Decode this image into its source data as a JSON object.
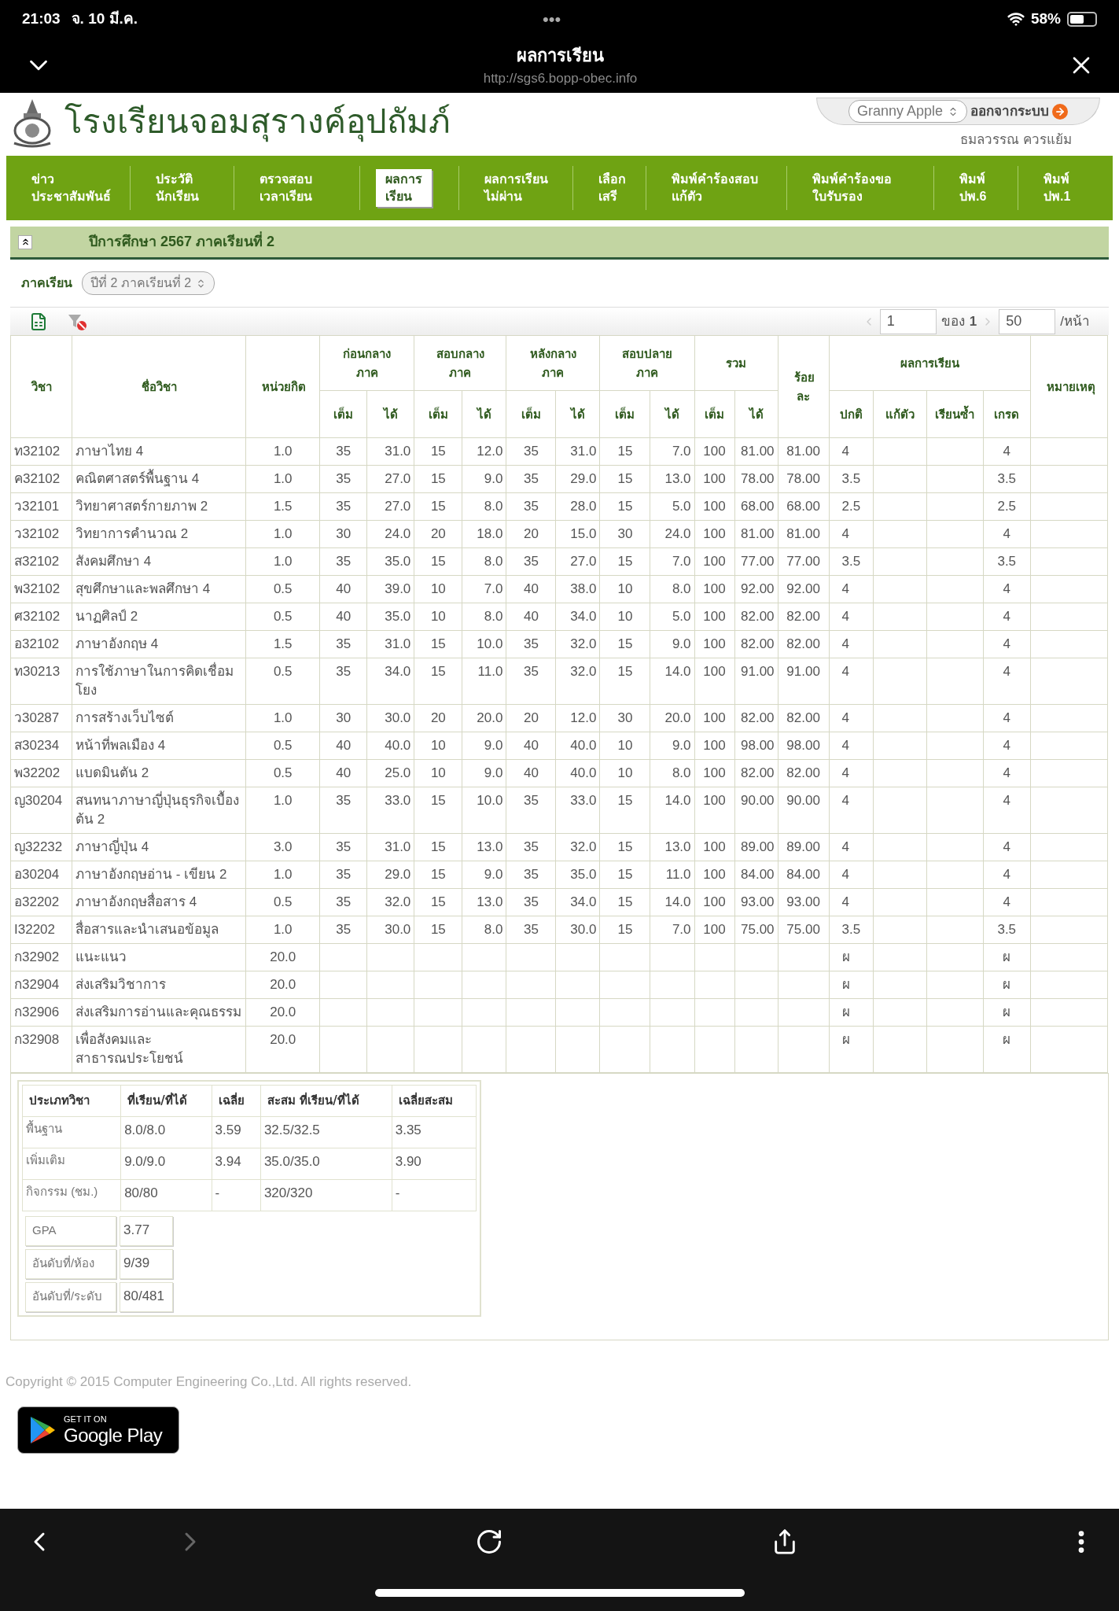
{
  "status_bar": {
    "time": "21:03",
    "date": "จ. 10 มี.ค.",
    "dots": "•••",
    "battery": "58%"
  },
  "browser": {
    "title": "ผลการเรียน",
    "url": "http://sgs6.bopp-obec.info"
  },
  "header": {
    "school_name": "โรงเรียนจอมสุรางค์อุปถัมภ์",
    "account_select": "Granny Apple",
    "logout": "ออกจากระบบ",
    "user_name": "ธมลวรรณ ควรแย้ม"
  },
  "nav": [
    {
      "lines": [
        "ข่าว",
        "ประชาสัมพันธ์"
      ],
      "selected": false
    },
    {
      "lines": [
        "ประวัติ",
        "นักเรียน"
      ],
      "selected": false
    },
    {
      "lines": [
        "ตรวจสอบ",
        "เวลาเรียน"
      ],
      "selected": false
    },
    {
      "lines": [
        "ผลการ",
        "เรียน"
      ],
      "selected": true
    },
    {
      "lines": [
        "ผลการเรียน",
        "ไม่ผ่าน"
      ],
      "selected": false
    },
    {
      "lines": [
        "เลือก",
        "เสรี"
      ],
      "selected": false
    },
    {
      "lines": [
        "พิมพ์คำร้องสอบ",
        "แก้ตัว"
      ],
      "selected": false
    },
    {
      "lines": [
        "พิมพ์คำร้องขอ",
        "ใบรับรอง"
      ],
      "selected": false
    },
    {
      "lines": [
        "พิมพ์",
        "ปพ.6"
      ],
      "selected": false
    },
    {
      "lines": [
        "พิมพ์",
        "ปพ.1"
      ],
      "selected": false
    }
  ],
  "section": {
    "title": "ปีการศึกษา 2567 ภาคเรียนที่ 2",
    "expanded": true
  },
  "semester": {
    "label": "ภาคเรียน",
    "value": "ปีที่ 2 ภาคเรียนที่ 2"
  },
  "pager": {
    "page": "1",
    "of": "ของ",
    "total": "1",
    "per_page": "50",
    "per_page_label": "/หน้า"
  },
  "table": {
    "columns": [
      {
        "label": "วิชา"
      },
      {
        "label": "ชื่อวิชา"
      },
      {
        "label": "หน่วยกิต"
      },
      {
        "label": "ก่อนกลางภาค",
        "sub": [
          "เต็ม",
          "ได้"
        ]
      },
      {
        "label": "สอบกลางภาค",
        "sub": [
          "เต็ม",
          "ได้"
        ]
      },
      {
        "label": "หลังกลางภาค",
        "sub": [
          "เต็ม",
          "ได้"
        ]
      },
      {
        "label": "สอบปลายภาค",
        "sub": [
          "เต็ม",
          "ได้"
        ]
      },
      {
        "label": "รวม",
        "sub": [
          "เต็ม",
          "ได้"
        ]
      },
      {
        "label": "ร้อยละ"
      },
      {
        "label": "ผลการเรียน",
        "sub": [
          "ปกติ",
          "แก้ตัว",
          "เรียนซ้ำ",
          "เกรด"
        ]
      },
      {
        "label": "หมายเหตุ"
      }
    ],
    "rows": [
      {
        "code": "ท32102",
        "name": "ภาษาไทย 4",
        "credit": "1.0",
        "scores": [
          "35",
          "31.0",
          "15",
          "12.0",
          "35",
          "31.0",
          "15",
          "7.0",
          "100",
          "81.00"
        ],
        "percent": "81.00",
        "normal": "4",
        "grade": "4"
      },
      {
        "code": "ค32102",
        "name": "คณิตศาสตร์พื้นฐาน 4",
        "credit": "1.0",
        "scores": [
          "35",
          "27.0",
          "15",
          "9.0",
          "35",
          "29.0",
          "15",
          "13.0",
          "100",
          "78.00"
        ],
        "percent": "78.00",
        "normal": "3.5",
        "grade": "3.5"
      },
      {
        "code": "ว32101",
        "name": "วิทยาศาสตร์กายภาพ 2",
        "credit": "1.5",
        "scores": [
          "35",
          "27.0",
          "15",
          "8.0",
          "35",
          "28.0",
          "15",
          "5.0",
          "100",
          "68.00"
        ],
        "percent": "68.00",
        "normal": "2.5",
        "grade": "2.5"
      },
      {
        "code": "ว32102",
        "name": "วิทยาการคำนวณ 2",
        "credit": "1.0",
        "scores": [
          "30",
          "24.0",
          "20",
          "18.0",
          "20",
          "15.0",
          "30",
          "24.0",
          "100",
          "81.00"
        ],
        "percent": "81.00",
        "normal": "4",
        "grade": "4"
      },
      {
        "code": "ส32102",
        "name": "สังคมศึกษา 4",
        "credit": "1.0",
        "scores": [
          "35",
          "35.0",
          "15",
          "8.0",
          "35",
          "27.0",
          "15",
          "7.0",
          "100",
          "77.00"
        ],
        "percent": "77.00",
        "normal": "3.5",
        "grade": "3.5"
      },
      {
        "code": "พ32102",
        "name": "สุขศึกษาและพลศึกษา 4",
        "credit": "0.5",
        "scores": [
          "40",
          "39.0",
          "10",
          "7.0",
          "40",
          "38.0",
          "10",
          "8.0",
          "100",
          "92.00"
        ],
        "percent": "92.00",
        "normal": "4",
        "grade": "4"
      },
      {
        "code": "ศ32102",
        "name": "นาฏศิลป์ 2",
        "credit": "0.5",
        "scores": [
          "40",
          "35.0",
          "10",
          "8.0",
          "40",
          "34.0",
          "10",
          "5.0",
          "100",
          "82.00"
        ],
        "percent": "82.00",
        "normal": "4",
        "grade": "4"
      },
      {
        "code": "อ32102",
        "name": "ภาษาอังกฤษ 4",
        "credit": "1.5",
        "scores": [
          "35",
          "31.0",
          "15",
          "10.0",
          "35",
          "32.0",
          "15",
          "9.0",
          "100",
          "82.00"
        ],
        "percent": "82.00",
        "normal": "4",
        "grade": "4"
      },
      {
        "code": "ท30213",
        "name": "การใช้ภาษาในการคิดเชื่อมโยง",
        "credit": "0.5",
        "scores": [
          "35",
          "34.0",
          "15",
          "11.0",
          "35",
          "32.0",
          "15",
          "14.0",
          "100",
          "91.00"
        ],
        "percent": "91.00",
        "normal": "4",
        "grade": "4"
      },
      {
        "code": "ว30287",
        "name": "การสร้างเว็บไซต์",
        "credit": "1.0",
        "scores": [
          "30",
          "30.0",
          "20",
          "20.0",
          "20",
          "12.0",
          "30",
          "20.0",
          "100",
          "82.00"
        ],
        "percent": "82.00",
        "normal": "4",
        "grade": "4"
      },
      {
        "code": "ส30234",
        "name": "หน้าที่พลเมือง 4",
        "credit": "0.5",
        "scores": [
          "40",
          "40.0",
          "10",
          "9.0",
          "40",
          "40.0",
          "10",
          "9.0",
          "100",
          "98.00"
        ],
        "percent": "98.00",
        "normal": "4",
        "grade": "4"
      },
      {
        "code": "พ32202",
        "name": "แบดมินตัน 2",
        "credit": "0.5",
        "scores": [
          "40",
          "25.0",
          "10",
          "9.0",
          "40",
          "40.0",
          "10",
          "8.0",
          "100",
          "82.00"
        ],
        "percent": "82.00",
        "normal": "4",
        "grade": "4"
      },
      {
        "code": "ญ30204",
        "name": "สนทนาภาษาญี่ปุ่นธุรกิจเบื้องต้น 2",
        "credit": "1.0",
        "scores": [
          "35",
          "33.0",
          "15",
          "10.0",
          "35",
          "33.0",
          "15",
          "14.0",
          "100",
          "90.00"
        ],
        "percent": "90.00",
        "normal": "4",
        "grade": "4"
      },
      {
        "code": "ญ32232",
        "name": "ภาษาญี่ปุ่น 4",
        "credit": "3.0",
        "scores": [
          "35",
          "31.0",
          "15",
          "13.0",
          "35",
          "32.0",
          "15",
          "13.0",
          "100",
          "89.00"
        ],
        "percent": "89.00",
        "normal": "4",
        "grade": "4"
      },
      {
        "code": "อ30204",
        "name": "ภาษาอังกฤษอ่าน - เขียน 2",
        "credit": "1.0",
        "scores": [
          "35",
          "29.0",
          "15",
          "9.0",
          "35",
          "35.0",
          "15",
          "11.0",
          "100",
          "84.00"
        ],
        "percent": "84.00",
        "normal": "4",
        "grade": "4"
      },
      {
        "code": "อ32202",
        "name": "ภาษาอังกฤษสื่อสาร 4",
        "credit": "0.5",
        "scores": [
          "35",
          "32.0",
          "15",
          "13.0",
          "35",
          "34.0",
          "15",
          "14.0",
          "100",
          "93.00"
        ],
        "percent": "93.00",
        "normal": "4",
        "grade": "4"
      },
      {
        "code": "I32202",
        "name": "สื่อสารและนำเสนอข้อมูล",
        "credit": "1.0",
        "scores": [
          "35",
          "30.0",
          "15",
          "8.0",
          "35",
          "30.0",
          "15",
          "7.0",
          "100",
          "75.00"
        ],
        "percent": "75.00",
        "normal": "3.5",
        "grade": "3.5"
      },
      {
        "code": "ก32902",
        "name": "แนะแนว",
        "credit": "20.0",
        "normal": "ผ",
        "grade": "ผ"
      },
      {
        "code": "ก32904",
        "name": "ส่งเสริมวิชาการ",
        "credit": "20.0",
        "normal": "ผ",
        "grade": "ผ"
      },
      {
        "code": "ก32906",
        "name": "ส่งเสริมการอ่านและคุณธรรม",
        "credit": "20.0",
        "normal": "ผ",
        "grade": "ผ"
      },
      {
        "code": "ก32908",
        "name": "เพื่อสังคมและสาธารณประโยชน์",
        "credit": "20.0",
        "normal": "ผ",
        "grade": "ผ"
      }
    ]
  },
  "summary": {
    "columns": [
      "ประเภทวิชา",
      "ที่เรียน/ที่ได้",
      "เฉลี่ย",
      "สะสม ที่เรียน/ที่ได้",
      "เฉลี่ยสะสม"
    ],
    "rows": [
      [
        "พื้นฐาน",
        "8.0/8.0",
        "3.59",
        "32.5/32.5",
        "3.35"
      ],
      [
        "เพิ่มเติม",
        "9.0/9.0",
        "3.94",
        "35.0/35.0",
        "3.90"
      ],
      [
        "กิจกรรม (ชม.)",
        "80/80",
        "-",
        "320/320",
        "-"
      ]
    ],
    "stats": [
      {
        "label": "GPA",
        "value": "3.77"
      },
      {
        "label": "อันดับที่/ห้อง",
        "value": "9/39"
      },
      {
        "label": "อันดับที่/ระดับ",
        "value": "80/481"
      }
    ]
  },
  "footer": {
    "copyright": "Copyright © 2015 Computer Engineering Co.,Ltd. All rights reserved.",
    "badge_small": "GET IT ON",
    "badge_large": "Google Play"
  },
  "toolbar": {
    "forward_disabled": true
  }
}
